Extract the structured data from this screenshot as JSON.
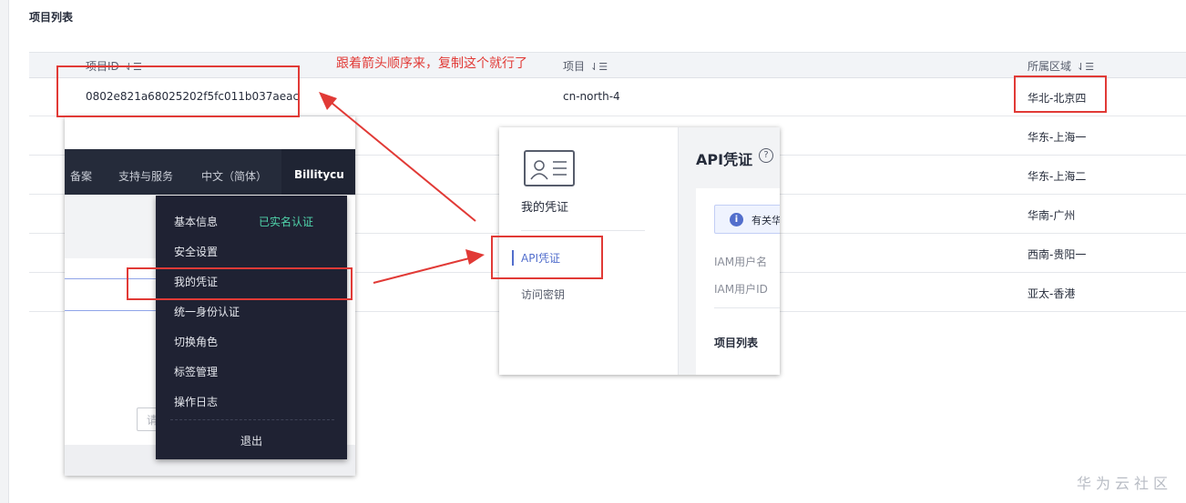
{
  "section_title": "项目列表",
  "table": {
    "columns": [
      "项目ID",
      "项目",
      "所属区域"
    ],
    "sort_icon": "⇃☰",
    "rows": [
      {
        "id": "0802e821a68025202f5fc011b037aeac",
        "project": "cn-north-4",
        "region": "华北-北京四"
      },
      {
        "id": "",
        "project": "",
        "region": "华东-上海一"
      },
      {
        "id": "",
        "project": "",
        "region": "华东-上海二"
      },
      {
        "id": "",
        "project": "",
        "region": "华南-广州"
      },
      {
        "id": "",
        "project": "",
        "region": "西南-贵阳一"
      },
      {
        "id": "",
        "project": "",
        "region": "亚太-香港"
      }
    ]
  },
  "annotation": "跟着箭头顺序来，复制这个就行了",
  "colors": {
    "annotation_red": "#e13a36",
    "nav_dark": "#252b3a",
    "accent_blue": "#526ecc",
    "verified_green": "#50d4ab"
  },
  "console_nav": {
    "items": [
      "备案",
      "支持与服务",
      "中文（简体）"
    ],
    "username": "Billitycu"
  },
  "user_menu": {
    "items": [
      "基本信息",
      "安全设置",
      "我的凭证",
      "统一身份认证",
      "切换角色",
      "标签管理",
      "操作日志"
    ],
    "verified_badge": "已实名认证",
    "logout": "退出",
    "search_placeholder": "请"
  },
  "credentials": {
    "sidebar_title": "我的凭证",
    "sidebar_items": [
      "API凭证",
      "访问密钥"
    ],
    "page_title": "API凭证",
    "help_icon": "?",
    "info_icon": "i",
    "notice": "有关华",
    "fields": [
      "IAM用户名",
      "IAM用户ID"
    ],
    "list_title": "项目列表"
  },
  "watermark": "华为云社区"
}
